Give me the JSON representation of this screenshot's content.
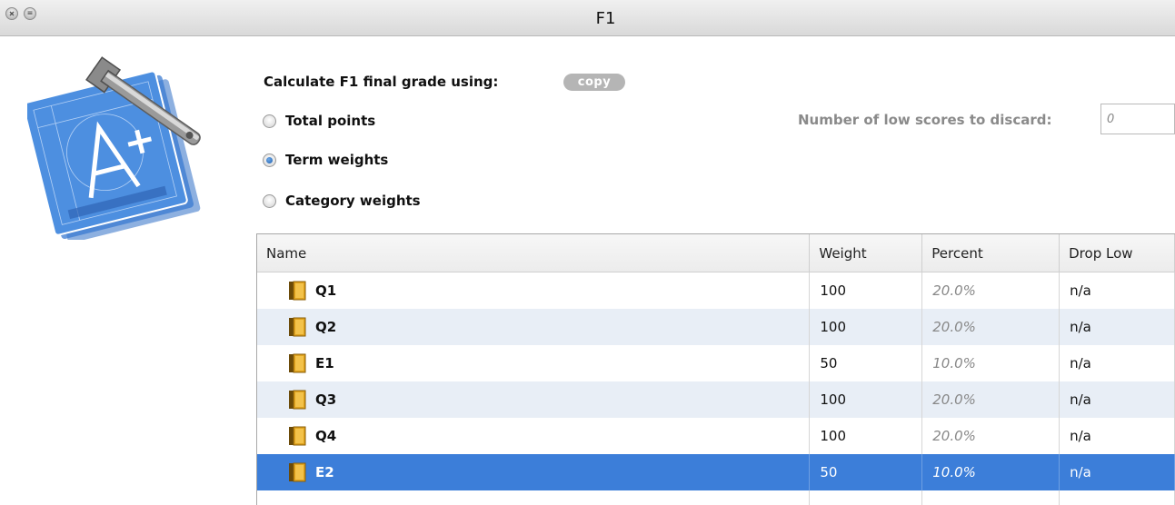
{
  "window": {
    "title": "F1"
  },
  "form": {
    "heading": "Calculate F1 final grade using:",
    "copy_label": "copy",
    "options": [
      {
        "label": "Total points",
        "selected": false
      },
      {
        "label": "Term weights",
        "selected": true
      },
      {
        "label": "Category weights",
        "selected": false
      }
    ],
    "discard_label": "Number of low scores to discard:",
    "discard_value": "0"
  },
  "table": {
    "headers": [
      "Name",
      "Weight",
      "Percent",
      "Drop Low"
    ],
    "rows": [
      {
        "name": "Q1",
        "weight": "100",
        "percent": "20.0%",
        "drop": "n/a"
      },
      {
        "name": "Q2",
        "weight": "100",
        "percent": "20.0%",
        "drop": "n/a"
      },
      {
        "name": "E1",
        "weight": "50",
        "percent": "10.0%",
        "drop": "n/a"
      },
      {
        "name": "Q3",
        "weight": "100",
        "percent": "20.0%",
        "drop": "n/a"
      },
      {
        "name": "Q4",
        "weight": "100",
        "percent": "20.0%",
        "drop": "n/a"
      },
      {
        "name": "E2",
        "weight": "50",
        "percent": "10.0%",
        "drop": "n/a"
      }
    ],
    "selected_row": 5,
    "row_icon": "book-icon"
  },
  "colors": {
    "selection": "#3c7ed9",
    "alt_row": "#e8eef6",
    "icon_blue": "#4d8fe0"
  }
}
